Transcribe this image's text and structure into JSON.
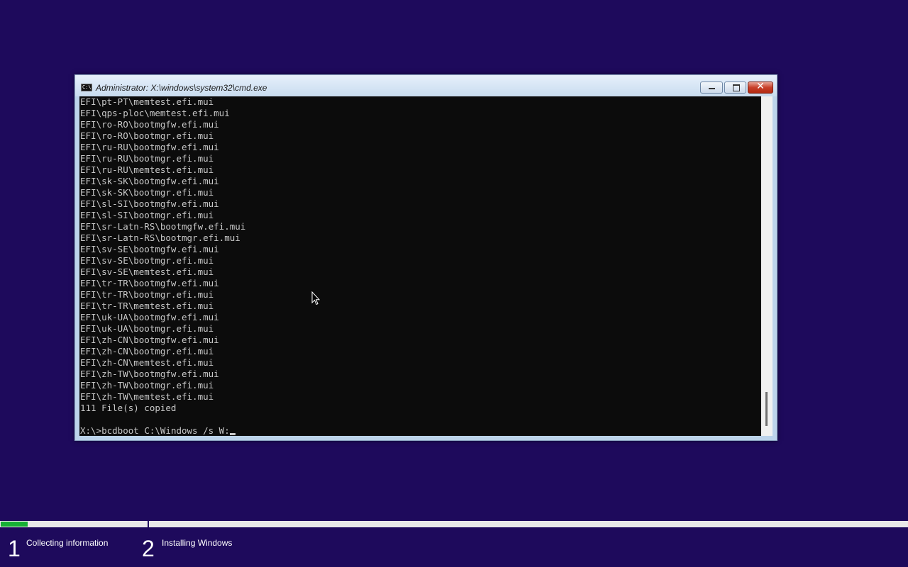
{
  "window": {
    "title": "Administrator: X:\\windows\\system32\\cmd.exe",
    "icon": "cmd-prompt-icon",
    "controls": [
      "minimize",
      "maximize",
      "close"
    ]
  },
  "console": {
    "lines": [
      "EFI\\pt-PT\\memtest.efi.mui",
      "EFI\\qps-ploc\\memtest.efi.mui",
      "EFI\\ro-RO\\bootmgfw.efi.mui",
      "EFI\\ro-RO\\bootmgr.efi.mui",
      "EFI\\ru-RU\\bootmgfw.efi.mui",
      "EFI\\ru-RU\\bootmgr.efi.mui",
      "EFI\\ru-RU\\memtest.efi.mui",
      "EFI\\sk-SK\\bootmgfw.efi.mui",
      "EFI\\sk-SK\\bootmgr.efi.mui",
      "EFI\\sl-SI\\bootmgfw.efi.mui",
      "EFI\\sl-SI\\bootmgr.efi.mui",
      "EFI\\sr-Latn-RS\\bootmgfw.efi.mui",
      "EFI\\sr-Latn-RS\\bootmgr.efi.mui",
      "EFI\\sv-SE\\bootmgfw.efi.mui",
      "EFI\\sv-SE\\bootmgr.efi.mui",
      "EFI\\sv-SE\\memtest.efi.mui",
      "EFI\\tr-TR\\bootmgfw.efi.mui",
      "EFI\\tr-TR\\bootmgr.efi.mui",
      "EFI\\tr-TR\\memtest.efi.mui",
      "EFI\\uk-UA\\bootmgfw.efi.mui",
      "EFI\\uk-UA\\bootmgr.efi.mui",
      "EFI\\zh-CN\\bootmgfw.efi.mui",
      "EFI\\zh-CN\\bootmgr.efi.mui",
      "EFI\\zh-CN\\memtest.efi.mui",
      "EFI\\zh-TW\\bootmgfw.efi.mui",
      "EFI\\zh-TW\\bootmgr.efi.mui",
      "EFI\\zh-TW\\memtest.efi.mui",
      "111 File(s) copied",
      ""
    ],
    "prompt": "X:\\>",
    "command": "bcdboot C:\\Windows /s W:"
  },
  "setup": {
    "progress_fraction": 0.03,
    "steps": [
      {
        "number": "1",
        "label": "Collecting information"
      },
      {
        "number": "2",
        "label": "Installing Windows"
      }
    ]
  },
  "colors": {
    "desktop_bg": "#1e0a5c",
    "console_bg": "#0c0c0c",
    "console_text": "#c8c8c8",
    "progress_fill": "#16b035"
  }
}
